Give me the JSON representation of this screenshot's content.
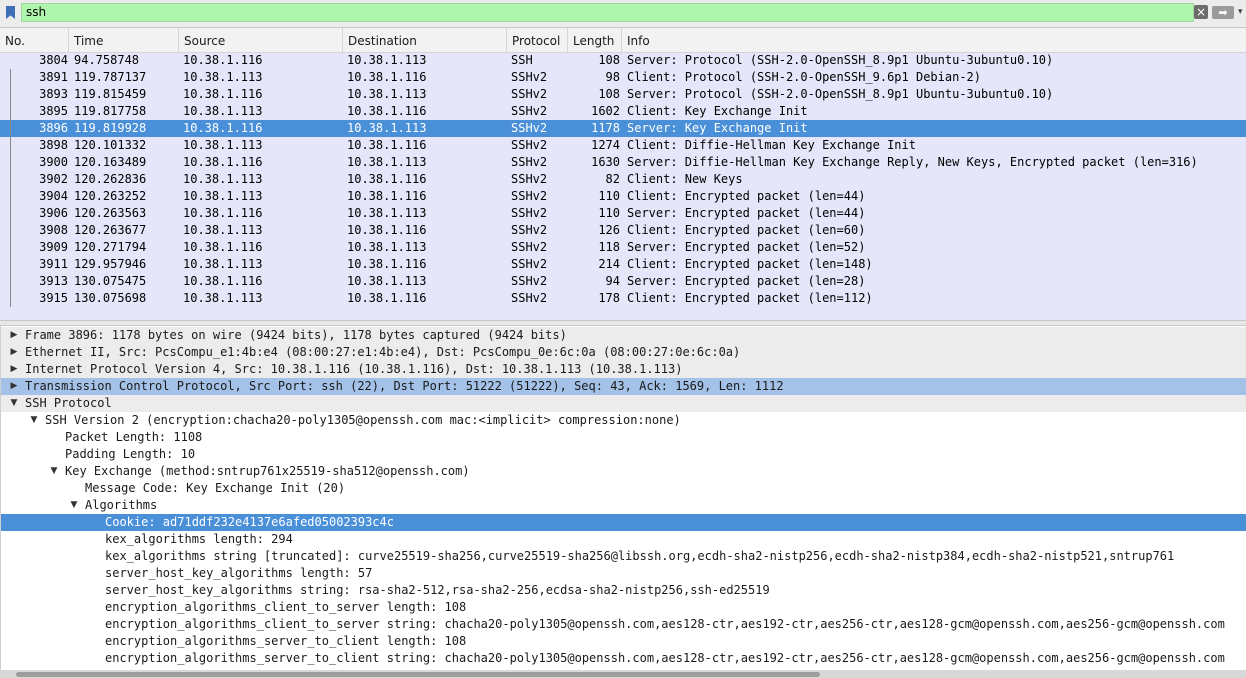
{
  "filter": {
    "value": "ssh",
    "clear_icon": "×",
    "apply_icon": "➡",
    "more_icon": "▾"
  },
  "columns": [
    "No.",
    "Time",
    "Source",
    "Destination",
    "Protocol",
    "Length",
    "Info"
  ],
  "packets": [
    {
      "no": "3804",
      "time": "94.758748",
      "src": "10.38.1.116",
      "dst": "10.38.1.113",
      "proto": "SSH",
      "len": "108",
      "info": "Server: Protocol (SSH-2.0-OpenSSH_8.9p1 Ubuntu-3ubuntu0.10)"
    },
    {
      "no": "3891",
      "time": "119.787137",
      "src": "10.38.1.113",
      "dst": "10.38.1.116",
      "proto": "SSHv2",
      "len": "98",
      "info": "Client: Protocol (SSH-2.0-OpenSSH_9.6p1 Debian-2)"
    },
    {
      "no": "3893",
      "time": "119.815459",
      "src": "10.38.1.116",
      "dst": "10.38.1.113",
      "proto": "SSHv2",
      "len": "108",
      "info": "Server: Protocol (SSH-2.0-OpenSSH_8.9p1 Ubuntu-3ubuntu0.10)"
    },
    {
      "no": "3895",
      "time": "119.817758",
      "src": "10.38.1.113",
      "dst": "10.38.1.116",
      "proto": "SSHv2",
      "len": "1602",
      "info": "Client: Key Exchange Init"
    },
    {
      "no": "3896",
      "time": "119.819928",
      "src": "10.38.1.116",
      "dst": "10.38.1.113",
      "proto": "SSHv2",
      "len": "1178",
      "info": "Server: Key Exchange Init"
    },
    {
      "no": "3898",
      "time": "120.101332",
      "src": "10.38.1.113",
      "dst": "10.38.1.116",
      "proto": "SSHv2",
      "len": "1274",
      "info": "Client: Diffie-Hellman Key Exchange Init"
    },
    {
      "no": "3900",
      "time": "120.163489",
      "src": "10.38.1.116",
      "dst": "10.38.1.113",
      "proto": "SSHv2",
      "len": "1630",
      "info": "Server: Diffie-Hellman Key Exchange Reply, New Keys, Encrypted packet (len=316)"
    },
    {
      "no": "3902",
      "time": "120.262836",
      "src": "10.38.1.113",
      "dst": "10.38.1.116",
      "proto": "SSHv2",
      "len": "82",
      "info": "Client: New Keys"
    },
    {
      "no": "3904",
      "time": "120.263252",
      "src": "10.38.1.113",
      "dst": "10.38.1.116",
      "proto": "SSHv2",
      "len": "110",
      "info": "Client: Encrypted packet (len=44)"
    },
    {
      "no": "3906",
      "time": "120.263563",
      "src": "10.38.1.116",
      "dst": "10.38.1.113",
      "proto": "SSHv2",
      "len": "110",
      "info": "Server: Encrypted packet (len=44)"
    },
    {
      "no": "3908",
      "time": "120.263677",
      "src": "10.38.1.113",
      "dst": "10.38.1.116",
      "proto": "SSHv2",
      "len": "126",
      "info": "Client: Encrypted packet (len=60)"
    },
    {
      "no": "3909",
      "time": "120.271794",
      "src": "10.38.1.116",
      "dst": "10.38.1.113",
      "proto": "SSHv2",
      "len": "118",
      "info": "Server: Encrypted packet (len=52)"
    },
    {
      "no": "3911",
      "time": "129.957946",
      "src": "10.38.1.113",
      "dst": "10.38.1.116",
      "proto": "SSHv2",
      "len": "214",
      "info": "Client: Encrypted packet (len=148)"
    },
    {
      "no": "3913",
      "time": "130.075475",
      "src": "10.38.1.116",
      "dst": "10.38.1.113",
      "proto": "SSHv2",
      "len": "94",
      "info": "Server: Encrypted packet (len=28)"
    },
    {
      "no": "3915",
      "time": "130.075698",
      "src": "10.38.1.113",
      "dst": "10.38.1.116",
      "proto": "SSHv2",
      "len": "178",
      "info": "Client: Encrypted packet (len=112)"
    }
  ],
  "selected_packet": "3896",
  "tree": [
    {
      "text": "Frame 3896: 1178 bytes on wire (9424 bits), 1178 bytes captured (9424 bits)",
      "depth": 0,
      "expander": "collapsed",
      "style": "hdr"
    },
    {
      "text": "Ethernet II, Src: PcsCompu_e1:4b:e4 (08:00:27:e1:4b:e4), Dst: PcsCompu_0e:6c:0a (08:00:27:0e:6c:0a)",
      "depth": 0,
      "expander": "collapsed",
      "style": "hdr"
    },
    {
      "text": "Internet Protocol Version 4, Src: 10.38.1.116 (10.38.1.116), Dst: 10.38.1.113 (10.38.1.113)",
      "depth": 0,
      "expander": "collapsed",
      "style": "hdr"
    },
    {
      "text": "Transmission Control Protocol, Src Port: ssh (22), Dst Port: 51222 (51222), Seq: 43, Ack: 1569, Len: 1112",
      "depth": 0,
      "expander": "collapsed",
      "style": "hl"
    },
    {
      "text": "SSH Protocol",
      "depth": 0,
      "expander": "expanded",
      "style": "hdr"
    },
    {
      "text": "SSH Version 2 (encryption:chacha20-poly1305@openssh.com mac:<implicit> compression:none)",
      "depth": 1,
      "expander": "expanded",
      "style": ""
    },
    {
      "text": "Packet Length: 1108",
      "depth": 2,
      "expander": "",
      "style": ""
    },
    {
      "text": "Padding Length: 10",
      "depth": 2,
      "expander": "",
      "style": ""
    },
    {
      "text": "Key Exchange (method:sntrup761x25519-sha512@openssh.com)",
      "depth": 2,
      "expander": "expanded",
      "style": "",
      "arrow_depth": 1
    },
    {
      "text": "Message Code: Key Exchange Init (20)",
      "depth": 3,
      "expander": "",
      "style": ""
    },
    {
      "text": "Algorithms",
      "depth": 3,
      "expander": "expanded",
      "style": ""
    },
    {
      "text": "Cookie: ad71ddf232e4137e6afed05002393c4c",
      "depth": 4,
      "expander": "",
      "style": "sel"
    },
    {
      "text": "kex_algorithms length: 294",
      "depth": 4,
      "expander": "",
      "style": ""
    },
    {
      "text": "kex_algorithms string [truncated]: curve25519-sha256,curve25519-sha256@libssh.org,ecdh-sha2-nistp256,ecdh-sha2-nistp384,ecdh-sha2-nistp521,sntrup761",
      "depth": 4,
      "expander": "",
      "style": ""
    },
    {
      "text": "server_host_key_algorithms length: 57",
      "depth": 4,
      "expander": "",
      "style": ""
    },
    {
      "text": "server_host_key_algorithms string: rsa-sha2-512,rsa-sha2-256,ecdsa-sha2-nistp256,ssh-ed25519",
      "depth": 4,
      "expander": "",
      "style": ""
    },
    {
      "text": "encryption_algorithms_client_to_server length: 108",
      "depth": 4,
      "expander": "",
      "style": ""
    },
    {
      "text": "encryption_algorithms_client_to_server string: chacha20-poly1305@openssh.com,aes128-ctr,aes192-ctr,aes256-ctr,aes128-gcm@openssh.com,aes256-gcm@openssh.com",
      "depth": 4,
      "expander": "",
      "style": ""
    },
    {
      "text": "encryption_algorithms_server_to_client length: 108",
      "depth": 4,
      "expander": "",
      "style": ""
    },
    {
      "text": "encryption_algorithms_server_to_client string: chacha20-poly1305@openssh.com,aes128-ctr,aes192-ctr,aes256-ctr,aes128-gcm@openssh.com,aes256-gcm@openssh.com",
      "depth": 4,
      "expander": "",
      "style": ""
    }
  ],
  "colors": {
    "selection": "#4a90d9",
    "packet_bg": "#e6e6fa",
    "filter_ok": "#aff5ad",
    "highlight": "#a4c2e8"
  }
}
